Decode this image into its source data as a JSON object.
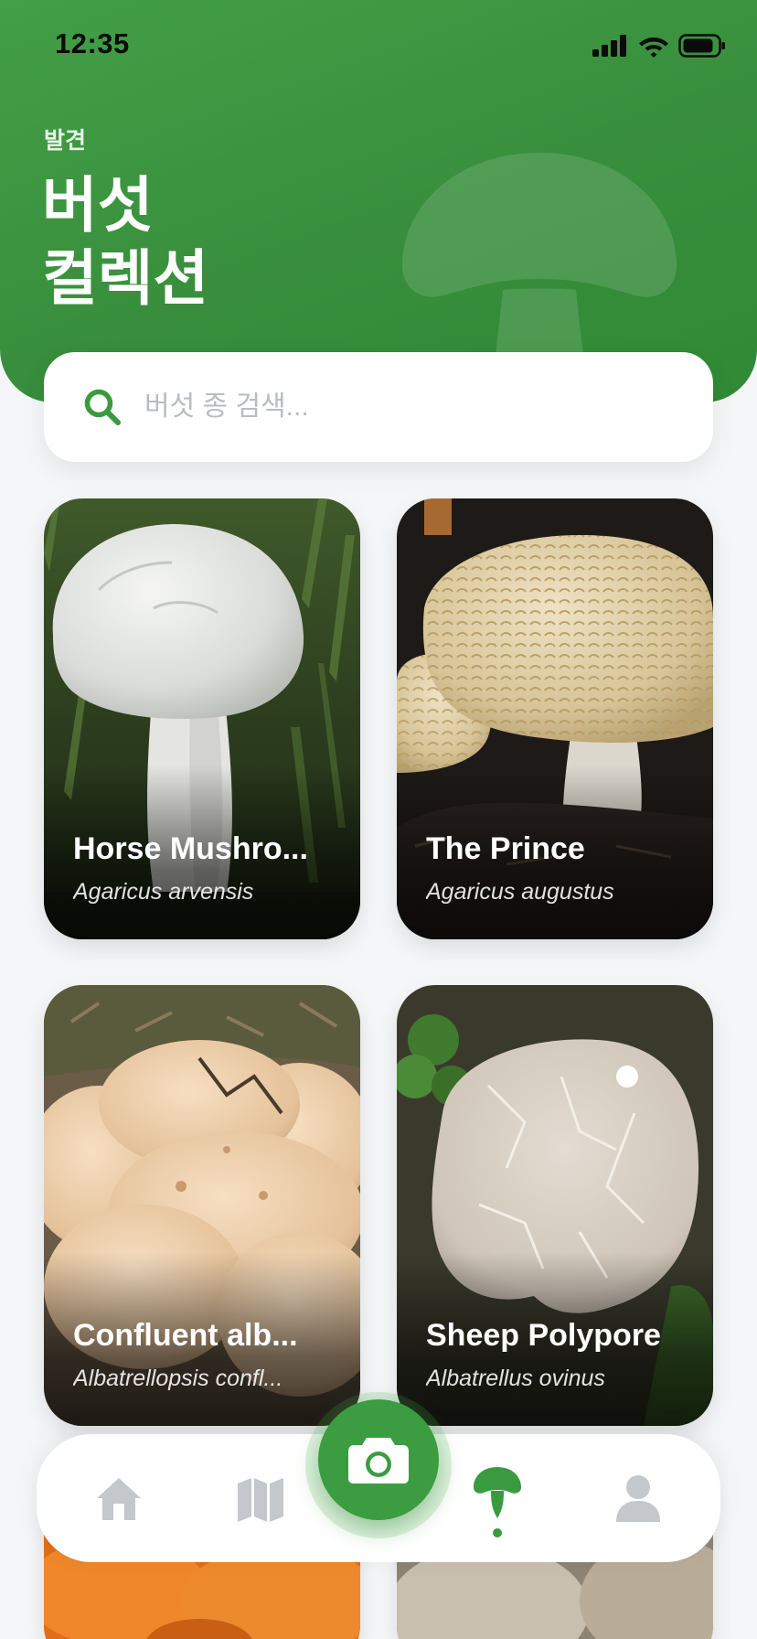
{
  "status_bar": {
    "time": "12:35",
    "icons": [
      "cellular-signal-icon",
      "wifi-icon",
      "battery-icon"
    ]
  },
  "header": {
    "eyebrow": "발견",
    "title": "버섯\n컬렉션",
    "background_color": "#3b9a40"
  },
  "search": {
    "placeholder": "버섯 종 검색...",
    "value": "",
    "icon": "search-icon"
  },
  "cards": [
    {
      "name": "Horse Mushroom",
      "display_name": "Horse Mushro...",
      "scientific": "Agaricus arvensis"
    },
    {
      "name": "The Prince",
      "display_name": "The Prince",
      "scientific": "Agaricus augustus"
    },
    {
      "name": "Confluent albatrellus",
      "display_name": "Confluent alb...",
      "scientific": "Albatrellopsis confl..."
    },
    {
      "name": "Sheep Polypore",
      "display_name": "Sheep Polypore",
      "scientific": "Albatrellus ovinus"
    }
  ],
  "bottom_nav": {
    "items": [
      {
        "icon": "home-icon",
        "active": false
      },
      {
        "icon": "map-icon",
        "active": false
      },
      {
        "icon": "camera-icon",
        "active": false
      },
      {
        "icon": "mushroom-icon",
        "active": true
      },
      {
        "icon": "profile-icon",
        "active": false
      }
    ],
    "accent_color": "#3c9c41",
    "inactive_color": "#c4c7cc"
  }
}
